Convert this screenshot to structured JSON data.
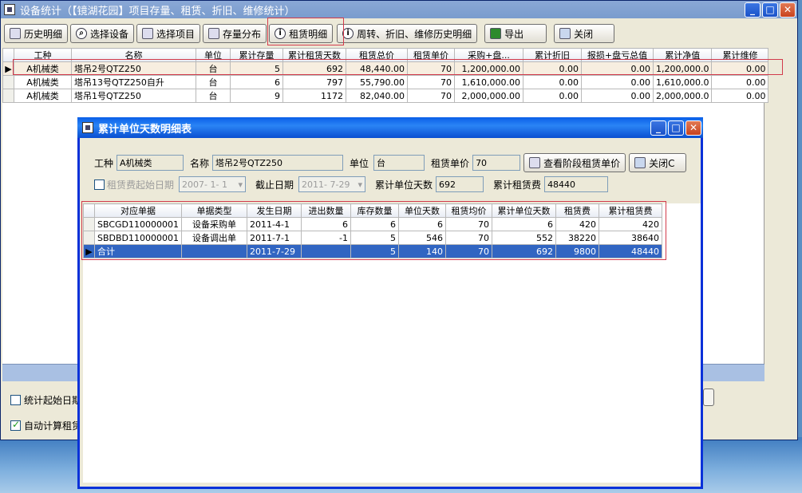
{
  "main": {
    "title": "设备统计（【镜湖花园】项目存量、租赁、折旧、维修统计）",
    "toolbar": [
      "历史明细",
      "选择设备",
      "选择项目",
      "存量分布",
      "租赁明细",
      "周转、折旧、维修历史明细",
      "导出",
      "关闭"
    ],
    "columns": [
      "工种",
      "名称",
      "单位",
      "累计存量",
      "累计租赁天数",
      "租赁总价",
      "租赁单价",
      "采购+盘...",
      "累计折旧",
      "报损+盘亏总值",
      "累计净值",
      "累计维修"
    ],
    "rows": [
      [
        "A机械类",
        "塔吊2号QTZ250",
        "台",
        "5",
        "692",
        "48,440.00",
        "70",
        "1,200,000.00",
        "0.00",
        "0.00",
        "1,200,000.0",
        "0.00"
      ],
      [
        "A机械类",
        "塔吊13号QTZ250自升",
        "台",
        "6",
        "797",
        "55,790.00",
        "70",
        "1,610,000.00",
        "0.00",
        "0.00",
        "1,610,000.0",
        "0.00"
      ],
      [
        "A机械类",
        "塔吊1号QTZ250",
        "台",
        "9",
        "1172",
        "82,040.00",
        "70",
        "2,000,000.00",
        "0.00",
        "0.00",
        "2,000,000.0",
        "0.00"
      ]
    ],
    "chk_start": "统计起始日期",
    "chk_auto": "自动计算租赁"
  },
  "dialog": {
    "title": "累计单位天数明细表",
    "lbl_type": "工种",
    "val_type": "A机械类",
    "lbl_name": "名称",
    "val_name": "塔吊2号QTZ250",
    "lbl_unit": "单位",
    "val_unit": "台",
    "lbl_price": "租赁单价",
    "val_price": "70",
    "btn_stage": "查看阶段租赁单价",
    "btn_close": "关闭C",
    "lbl_startdate": "租赁费起始日期",
    "val_startdate": "2007- 1- 1",
    "lbl_enddate": "截止日期",
    "val_enddate": "2011- 7-29",
    "lbl_days": "累计单位天数",
    "val_days": "692",
    "lbl_fee": "累计租赁费",
    "val_fee": "48440",
    "columns": [
      "对应单据",
      "单据类型",
      "发生日期",
      "进出数量",
      "库存数量",
      "单位天数",
      "租赁均价",
      "累计单位天数",
      "租赁费",
      "累计租赁费"
    ],
    "rows": [
      [
        "SBCGD110000001",
        "设备采购单",
        "2011-4-1",
        "6",
        "6",
        "6",
        "70",
        "6",
        "420",
        "420"
      ],
      [
        "SBDBD110000001",
        "设备调出单",
        "2011-7-1",
        "-1",
        "5",
        "546",
        "70",
        "552",
        "38220",
        "38640"
      ]
    ],
    "total": [
      "合计",
      "",
      "2011-7-29",
      "",
      "5",
      "140",
      "70",
      "692",
      "9800",
      "48440"
    ]
  }
}
